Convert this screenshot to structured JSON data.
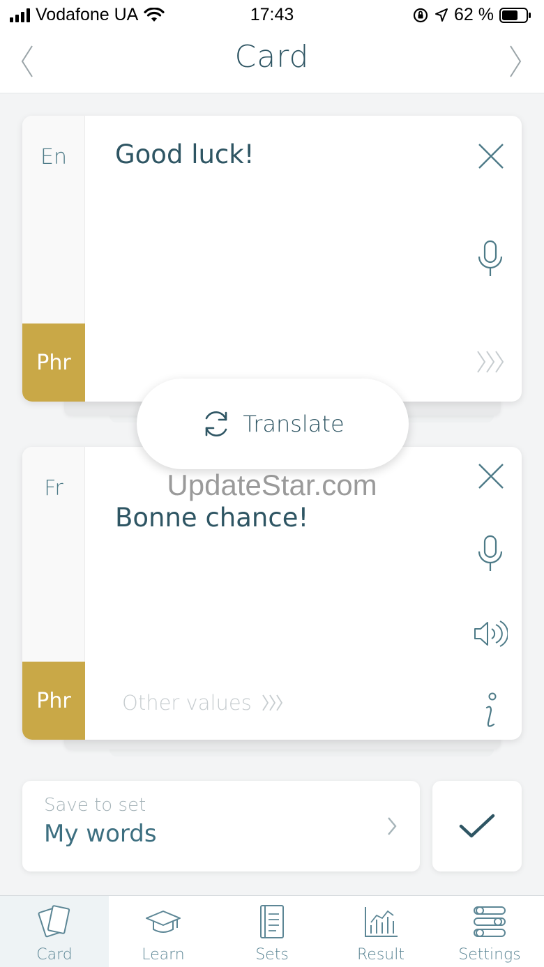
{
  "status_bar": {
    "carrier": "Vodafone UA",
    "time": "17:43",
    "battery": "62 %"
  },
  "nav": {
    "title": "Card"
  },
  "source_card": {
    "lang": "En",
    "type": "Phr",
    "text": "Good luck!"
  },
  "translate_button": {
    "label": "Translate"
  },
  "watermark": "UpdateStar.com",
  "target_card": {
    "lang": "Fr",
    "type": "Phr",
    "text": "Bonne chance!",
    "other_values": "Other values"
  },
  "save": {
    "hint": "Save to set",
    "value": "My words"
  },
  "tabs": [
    {
      "label": "Card",
      "icon": "cards-icon",
      "active": true
    },
    {
      "label": "Learn",
      "icon": "graduation-cap-icon",
      "active": false
    },
    {
      "label": "Sets",
      "icon": "notebook-icon",
      "active": false
    },
    {
      "label": "Result",
      "icon": "bar-chart-icon",
      "active": false
    },
    {
      "label": "Settings",
      "icon": "sliders-icon",
      "active": false
    }
  ],
  "colors": {
    "primary": "#2e5563",
    "accent": "#c9a847",
    "background": "#f3f4f5"
  }
}
